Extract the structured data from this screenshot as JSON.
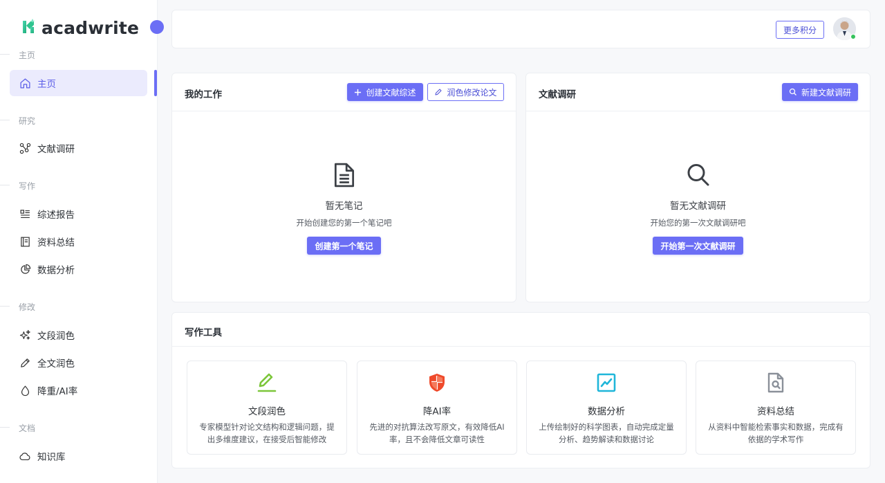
{
  "app": {
    "name": "acadwrite"
  },
  "sidebar": {
    "sections": [
      {
        "label": "主页",
        "items": [
          {
            "label": "主页",
            "icon": "home-icon",
            "active": true
          }
        ]
      },
      {
        "label": "研究",
        "items": [
          {
            "label": "文献调研",
            "icon": "graph-nodes-icon"
          }
        ]
      },
      {
        "label": "写作",
        "items": [
          {
            "label": "综述报告",
            "icon": "list-report-icon"
          },
          {
            "label": "资料总结",
            "icon": "notebook-icon"
          },
          {
            "label": "数据分析",
            "icon": "pie-chart-icon"
          }
        ]
      },
      {
        "label": "修改",
        "items": [
          {
            "label": "文段润色",
            "icon": "sparkle-icon"
          },
          {
            "label": "全文润色",
            "icon": "pencil-icon"
          },
          {
            "label": "降重/AI率",
            "icon": "droplet-icon"
          }
        ]
      },
      {
        "label": "文档",
        "items": [
          {
            "label": "知识库",
            "icon": "cloud-icon"
          }
        ]
      }
    ]
  },
  "header": {
    "points_button": "更多积分"
  },
  "my_work": {
    "title": "我的工作",
    "create_button": "创建文献综述",
    "polish_button": "润色修改论文",
    "empty_title": "暂无笔记",
    "empty_subtitle": "开始创建您的第一个笔记吧",
    "empty_button": "创建第一个笔记"
  },
  "research": {
    "title": "文献调研",
    "new_button": "新建文献调研",
    "empty_title": "暂无文献调研",
    "empty_subtitle": "开始您的第一次文献调研吧",
    "empty_button": "开始第一次文献调研"
  },
  "tools": {
    "title": "写作工具",
    "items": [
      {
        "title": "文段润色",
        "desc": "专家模型针对论文结构和逻辑问题，提出多维度建议，在接受后智能修改",
        "icon": "edit-pencil-icon",
        "color": "#7cc63a"
      },
      {
        "title": "降AI率",
        "desc": "先进的对抗算法改写原文，有效降低AI率，且不会降低文章可读性",
        "icon": "shield-icon",
        "color": "#ef4a2b"
      },
      {
        "title": "数据分析",
        "desc": "上传绘制好的科学图表，自动完成定量分析、趋势解读和数据讨论",
        "icon": "chart-icon",
        "color": "#1fb6d9"
      },
      {
        "title": "资料总结",
        "desc": "从资料中智能检索事实和数据，完成有依据的学术写作",
        "icon": "doc-search-icon",
        "color": "#8a9099"
      }
    ]
  },
  "colors": {
    "accent": "#6b6ef5",
    "active_bg": "#ebebfd"
  }
}
